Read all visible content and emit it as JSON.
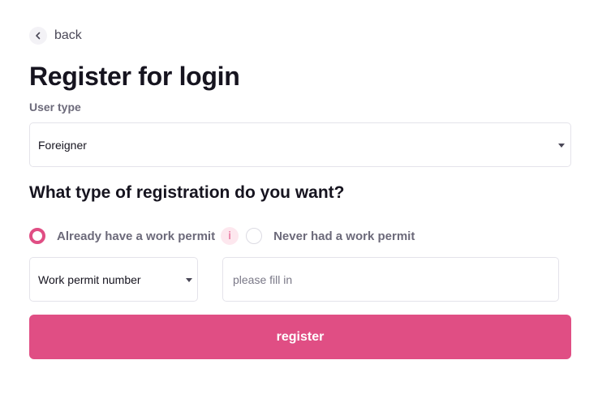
{
  "nav": {
    "back_label": "back",
    "back_icon": "chevron-left-icon"
  },
  "page": {
    "title": "Register for login"
  },
  "user_type": {
    "label": "User type",
    "selected": "Foreigner"
  },
  "registration": {
    "question": "What type of registration do you want?",
    "options": [
      {
        "label": "Already have a work permit",
        "checked": true
      },
      {
        "label": "Never had a work permit",
        "checked": false
      }
    ],
    "info_badge": "i"
  },
  "permit": {
    "type_selected": "Work permit number",
    "input_value": "",
    "input_placeholder": "please fill in"
  },
  "actions": {
    "register_label": "register"
  },
  "colors": {
    "accent": "#e04e84",
    "text": "#16141f",
    "muted": "#6c6a7a",
    "border": "#e4e3ea"
  }
}
